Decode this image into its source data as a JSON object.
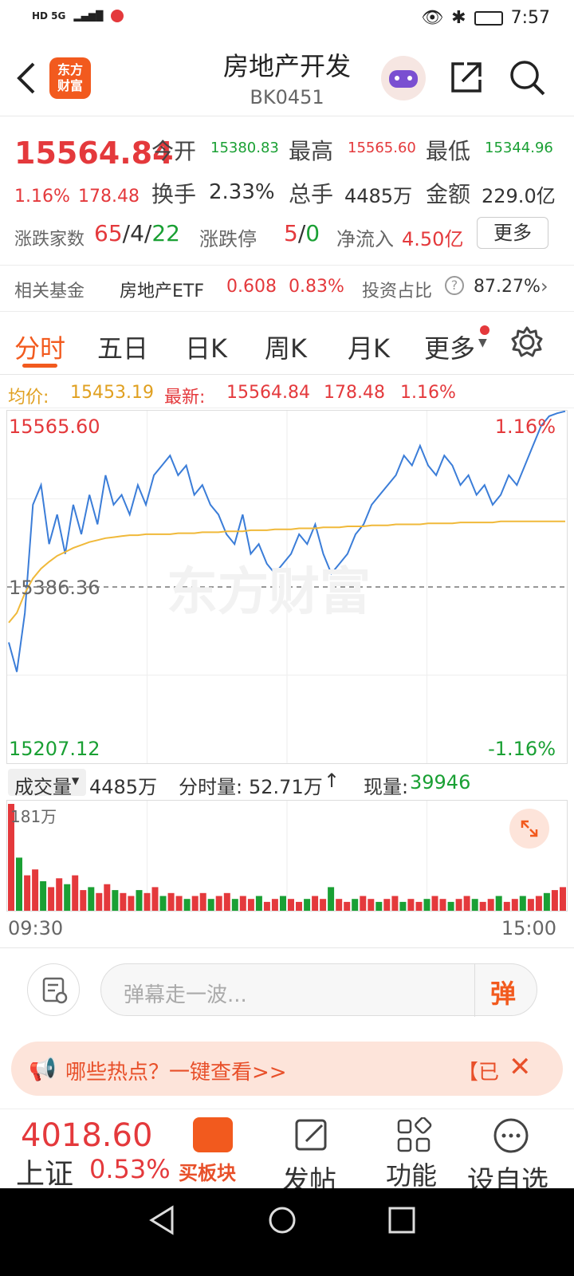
{
  "status_bar": {
    "left": "HD 5G",
    "time": "7:57"
  },
  "header": {
    "title": "房地产开发",
    "code": "BK0451",
    "logo_line1": "东方",
    "logo_line2": "财富"
  },
  "quote": {
    "price": "15564.84",
    "change_pct": "1.16%",
    "change_amt": "178.48",
    "open_label": "今开",
    "open": "15380.83",
    "high_label": "最高",
    "high": "15565.60",
    "low_label": "最低",
    "low": "15344.96",
    "turnover_label": "换手",
    "turnover": "2.33%",
    "volume_label": "总手",
    "volume": "4485万",
    "amount_label": "金额",
    "amount": "229.0亿",
    "updown_label": "涨跌家数",
    "up": "65",
    "flat": "4",
    "down": "22",
    "limit_label": "涨跌停",
    "limit_up": "5",
    "limit_down": "0",
    "netflow_label": "净流入",
    "netflow": "4.50亿",
    "more_button": "更多"
  },
  "fund": {
    "label": "相关基金",
    "name": "房地产ETF",
    "price": "0.608",
    "pct": "0.83%",
    "ratio_label": "投资占比",
    "ratio": "87.27%"
  },
  "tabs": [
    "分时",
    "五日",
    "日K",
    "周K",
    "月K",
    "更多"
  ],
  "info": {
    "avg_label": "均价:",
    "avg": "15453.19",
    "latest_label": "最新:",
    "latest": "15564.84",
    "chg": "178.48",
    "pct": "1.16%"
  },
  "chart_labels": {
    "top": "15565.60",
    "top_pct": "1.16%",
    "mid": "15386.36",
    "bottom": "15207.12",
    "bottom_pct": "-1.16%",
    "watermark": "东方财富"
  },
  "volume_header": {
    "selector": "成交量",
    "total": "4485万",
    "minute_label": "分时量:",
    "minute": "52.71万",
    "current_label": "现量:",
    "current": "39946",
    "max": "181万"
  },
  "time_axis": {
    "start": "09:30",
    "end": "15:00"
  },
  "comment": {
    "placeholder": "弹幕走一波...",
    "send": "弹"
  },
  "banner": {
    "text": "哪些热点？一键查看>>",
    "tag": "【已"
  },
  "bottom_nav": {
    "index_value": "4018.60",
    "index_name": "上证",
    "index_pct": "0.53%",
    "buy_label": "买板块",
    "post_label": "发帖",
    "func_label": "功能",
    "watch_label": "设自选"
  },
  "chart_data": {
    "type": "line",
    "title": "",
    "series": [
      {
        "name": "最新",
        "values": [
          15330,
          15300,
          15360,
          15470,
          15490,
          15430,
          15460,
          15420,
          15470,
          15440,
          15480,
          15450,
          15500,
          15470,
          15480,
          15460,
          15490,
          15470,
          15500,
          15510,
          15520,
          15500,
          15510,
          15480,
          15490,
          15470,
          15460,
          15440,
          15430,
          15460,
          15420,
          15430,
          15410,
          15400,
          15410,
          15420,
          15440,
          15430,
          15450,
          15420,
          15400,
          15410,
          15420,
          15440,
          15450,
          15470,
          15480,
          15490,
          15500,
          15520,
          15510,
          15530,
          15510,
          15500,
          15520,
          15510,
          15490,
          15500,
          15480,
          15490,
          15470,
          15480,
          15500,
          15490,
          15510,
          15530,
          15550,
          15560,
          15563,
          15565
        ]
      },
      {
        "name": "均价",
        "values": [
          15350,
          15360,
          15380,
          15395,
          15405,
          15412,
          15418,
          15422,
          15426,
          15429,
          15432,
          15434,
          15436,
          15437,
          15438,
          15439,
          15439,
          15440,
          15440,
          15440,
          15440,
          15441,
          15441,
          15441,
          15442,
          15442,
          15442,
          15443,
          15443,
          15443,
          15444,
          15444,
          15444,
          15445,
          15445,
          15445,
          15446,
          15446,
          15446,
          15447,
          15447,
          15447,
          15448,
          15448,
          15448,
          15449,
          15449,
          15449,
          15450,
          15450,
          15450,
          15450,
          15451,
          15451,
          15451,
          15451,
          15452,
          15452,
          15452,
          15452,
          15452,
          15453,
          15453,
          15453,
          15453,
          15453,
          15453,
          15453,
          15453,
          15453
        ]
      }
    ],
    "ylim": [
      15207.12,
      15565.6
    ],
    "baseline": 15386.36,
    "volume": [
      181,
      90,
      60,
      70,
      50,
      40,
      55,
      45,
      60,
      35,
      40,
      30,
      45,
      35,
      30,
      25,
      35,
      30,
      40,
      25,
      30,
      25,
      20,
      25,
      30,
      20,
      25,
      30,
      20,
      25,
      20,
      25,
      15,
      20,
      25,
      20,
      15,
      20,
      25,
      20,
      40,
      20,
      15,
      20,
      25,
      20,
      15,
      20,
      25,
      15,
      20,
      15,
      20,
      25,
      20,
      15,
      20,
      25,
      20,
      15,
      20,
      25,
      15,
      20,
      25,
      20,
      25,
      30,
      35,
      40
    ]
  }
}
